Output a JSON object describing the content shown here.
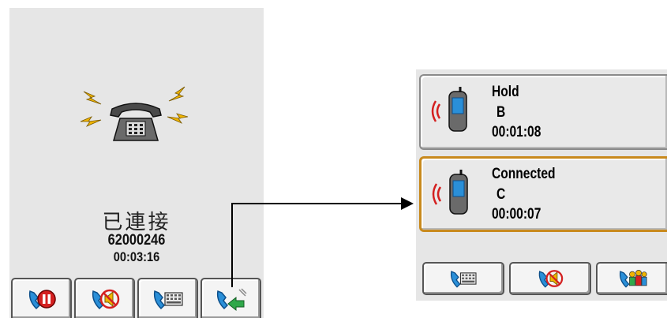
{
  "left_screen": {
    "status": "已連接",
    "number": "62000246",
    "timer": "00:03:16",
    "softkeys": [
      {
        "icon": "phone-hold-icon"
      },
      {
        "icon": "phone-mute-icon"
      },
      {
        "icon": "phone-keypad-icon"
      },
      {
        "icon": "phone-transfer-icon"
      }
    ]
  },
  "right_screen": {
    "calls": [
      {
        "state": "Hold",
        "name": "B",
        "duration": "00:01:08",
        "active": false
      },
      {
        "state": "Connected",
        "name": "C",
        "duration": "00:00:07",
        "active": true
      }
    ],
    "softkeys": [
      {
        "icon": "phone-keypad-icon"
      },
      {
        "icon": "phone-mute-icon"
      },
      {
        "icon": "phone-conference-icon"
      }
    ]
  },
  "colors": {
    "screen_bg": "#e6e6e6",
    "active_border": "#c8891c",
    "signal_red": "#d42020",
    "handset_blue": "#2a8fd8",
    "lightning": "#f0b400"
  }
}
